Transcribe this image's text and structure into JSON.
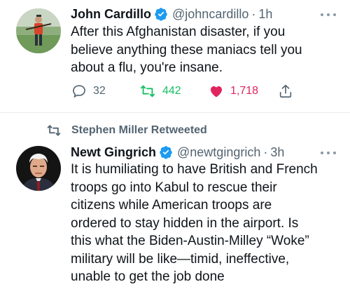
{
  "tweet1": {
    "author_name": "John Cardillo",
    "handle": "@johncardillo",
    "separator": "·",
    "time": "1h",
    "text_lines": [
      "After this Afghanistan disaster, if you",
      "believe anything these maniacs tell you",
      "about a flu, you're insane."
    ],
    "replies": "32",
    "retweets": "442",
    "likes": "1,718",
    "colors": {
      "retweet": "#17bf63",
      "like": "#e0245e"
    }
  },
  "retweet_notice": "Stephen Miller Retweeted",
  "tweet2": {
    "author_name": "Newt Gingrich",
    "handle": "@newtgingrich",
    "separator": "·",
    "time": "3h",
    "text_lines": [
      "It is humiliating to have British and French",
      "troops go into Kabul to rescue their",
      "citizens while American troops are",
      "ordered to stay hidden in the airport. Is",
      "this what the Biden-Austin-Milley “Woke”",
      "military will be like—timid, ineffective,",
      "unable to get the job done"
    ]
  },
  "colors": {
    "verified": "#1d9bf0",
    "secondary_text": "#536471"
  }
}
